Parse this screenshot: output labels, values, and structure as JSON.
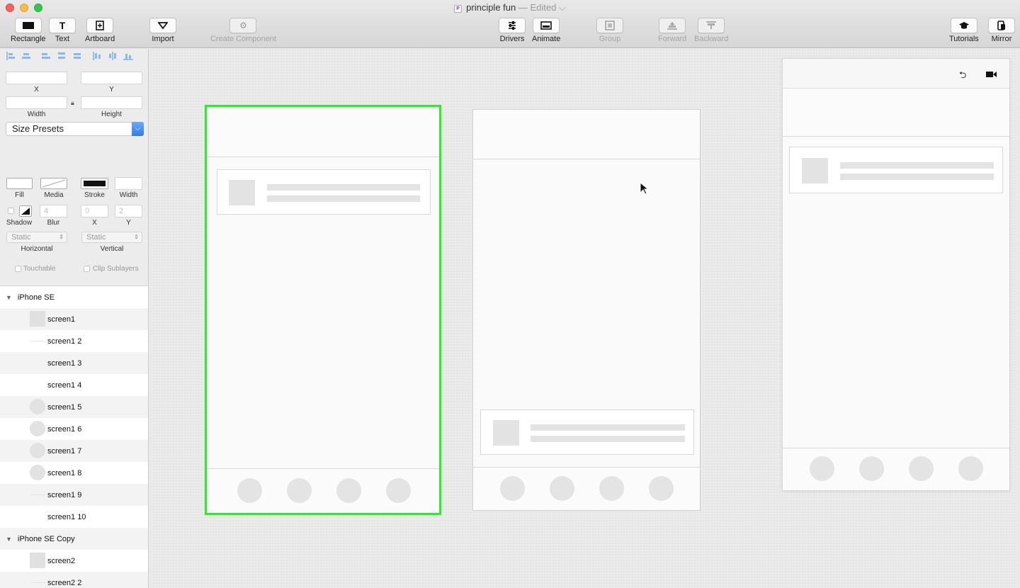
{
  "window": {
    "title": "principle fun",
    "status": "— Edited",
    "app_icon": "P"
  },
  "toolbar": {
    "rectangle": "Rectangle",
    "text": "Text",
    "artboard": "Artboard",
    "import": "Import",
    "create_component": "Create Component",
    "drivers": "Drivers",
    "animate": "Animate",
    "group": "Group",
    "forward": "Forward",
    "backward": "Backward",
    "tutorials": "Tutorials",
    "mirror": "Mirror"
  },
  "inspector": {
    "x_label": "X",
    "y_label": "Y",
    "width_label": "Width",
    "height_label": "Height",
    "size_presets": "Size Presets",
    "fill_label": "Fill",
    "media_label": "Media",
    "stroke_label": "Stroke",
    "stroke_width_label": "Width",
    "shadow_label": "Shadow",
    "blur_label": "Blur",
    "shadow_x_label": "X",
    "shadow_y_label": "Y",
    "blur_value": "4",
    "shadow_x_value": "0",
    "shadow_y_value": "2",
    "horizontal_value": "Static",
    "horizontal_label": "Horizontal",
    "vertical_value": "Static",
    "vertical_label": "Vertical",
    "touchable_label": "Touchable",
    "clip_sublayers_label": "Clip Sublayers"
  },
  "layers": {
    "groups": [
      {
        "name": "iPhone SE",
        "children": [
          {
            "name": "screen1",
            "thumb": "rect"
          },
          {
            "name": "screen1 2",
            "thumb": "line"
          },
          {
            "name": "screen1 3",
            "thumb": "none"
          },
          {
            "name": "screen1 4",
            "thumb": "none"
          },
          {
            "name": "screen1 5",
            "thumb": "circle"
          },
          {
            "name": "screen1 6",
            "thumb": "circle"
          },
          {
            "name": "screen1 7",
            "thumb": "circle"
          },
          {
            "name": "screen1 8",
            "thumb": "circle"
          },
          {
            "name": "screen1 9",
            "thumb": "line"
          },
          {
            "name": "screen1 10",
            "thumb": "none"
          }
        ]
      },
      {
        "name": "iPhone SE Copy",
        "children": [
          {
            "name": "screen2",
            "thumb": "rect"
          },
          {
            "name": "screen2 2",
            "thumb": "line"
          }
        ]
      }
    ]
  },
  "preview": {
    "undo_icon": "⮌",
    "record_icon": "■"
  },
  "colors": {
    "selection": "#23f320",
    "accent": "#2f7ee6"
  }
}
